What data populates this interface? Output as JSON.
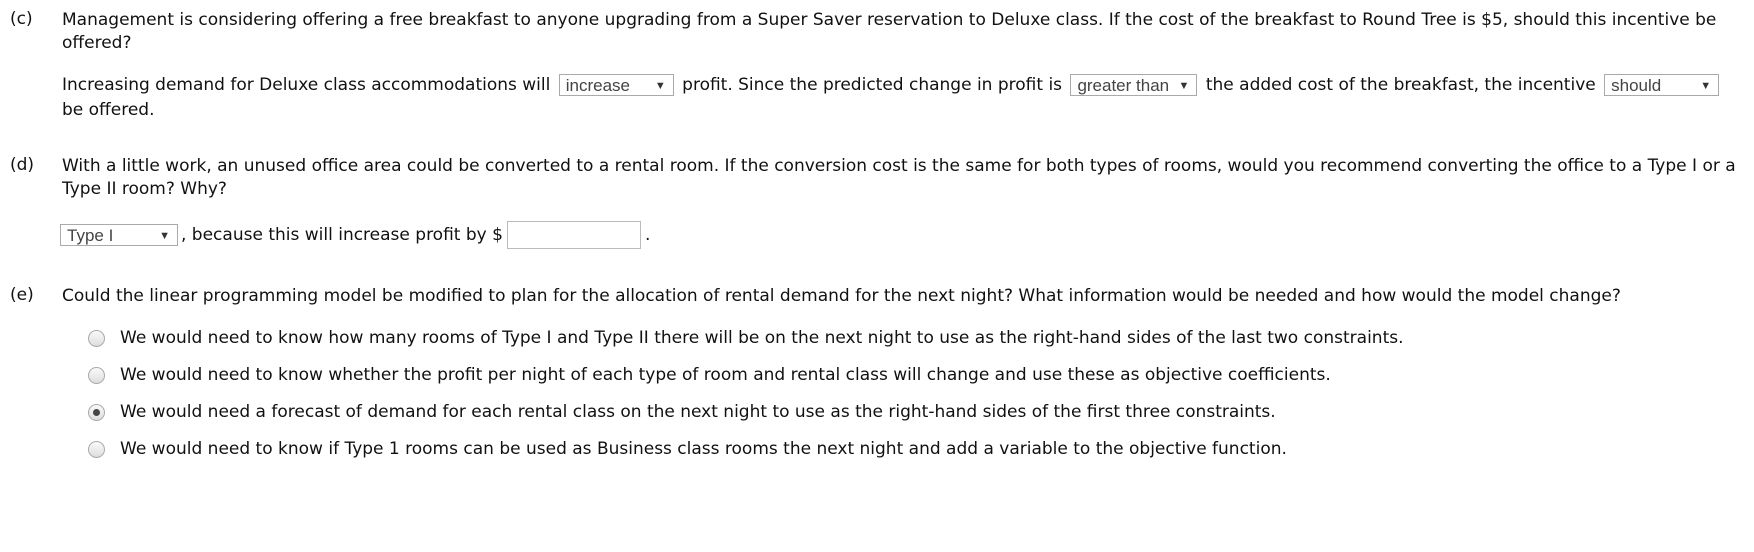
{
  "c": {
    "label": "(c)",
    "question": "Management is considering offering a free breakfast to anyone upgrading from a Super Saver reservation to Deluxe class. If the cost of the breakfast to Round Tree is $5, should this incentive be offered?",
    "t1": "Increasing demand for Deluxe class accommodations will",
    "sel1": "increase",
    "t2": "profit. Since the predicted change in profit is",
    "sel2": "greater than",
    "t3": "the added cost of the breakfast, the incentive",
    "sel3": "should",
    "t4": "be offered."
  },
  "d": {
    "label": "(d)",
    "question": "With a little work, an unused office area could be converted to a rental room. If the conversion cost is the same for both types of rooms, would you recommend converting the office to a Type I or a Type II room? Why?",
    "sel1": "Type I",
    "t1": ", because this will increase profit by $",
    "input_value": "",
    "t2": "."
  },
  "e": {
    "label": "(e)",
    "question": "Could the linear programming model be modified to plan for the allocation of rental demand for the next night? What information would be needed and how would the model change?",
    "options": [
      {
        "text": "We would need to know how many rooms of Type I and Type II there will be on the next night to use as the right-hand sides of the last two constraints.",
        "selected": false
      },
      {
        "text": "We would need to know whether the profit per night of each type of room and rental class will change and use these as objective coefficients.",
        "selected": false
      },
      {
        "text": "We would need a forecast of demand for each rental class on the next night to use as the right-hand sides of the first three constraints.",
        "selected": true
      },
      {
        "text": "We would need to know if Type 1 rooms can be used as Business class rooms the next night and add a variable to the objective function.",
        "selected": false
      }
    ]
  }
}
